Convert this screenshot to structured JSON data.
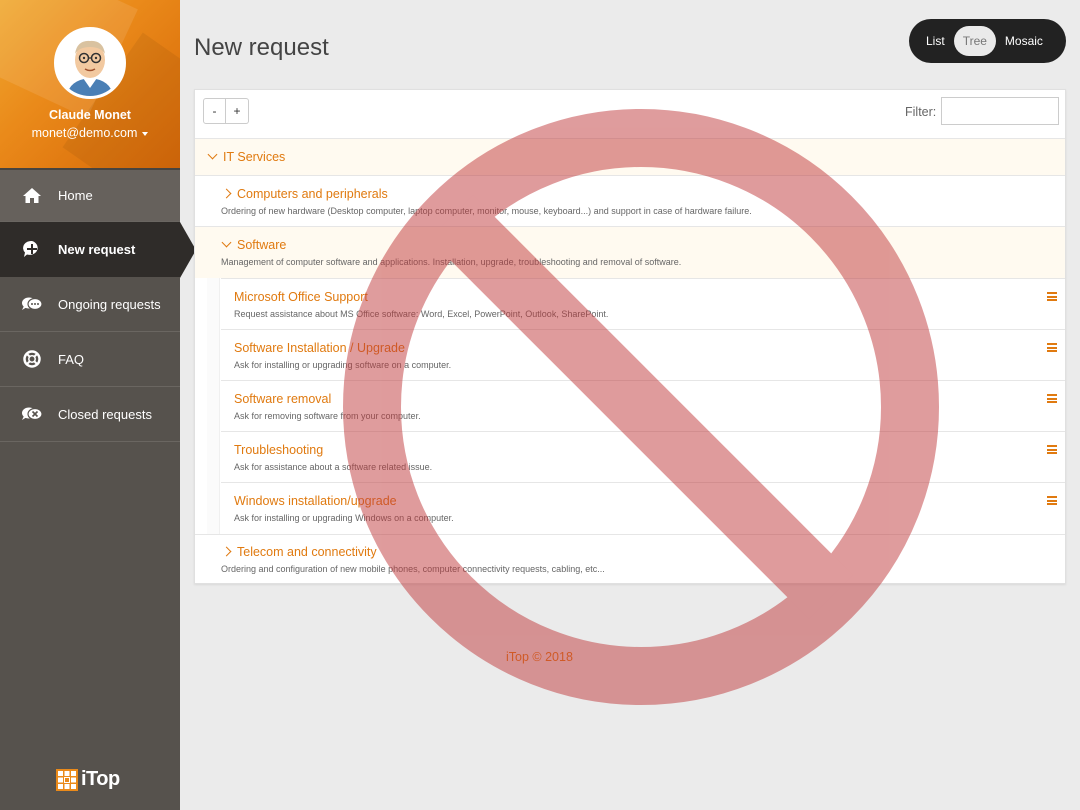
{
  "user": {
    "name": "Claude Monet",
    "email": "monet@demo.com"
  },
  "nav": [
    {
      "label": "Home",
      "icon": "home-icon"
    },
    {
      "label": "New request",
      "icon": "plus-circle-icon"
    },
    {
      "label": "Ongoing requests",
      "icon": "chat-bubbles-icon"
    },
    {
      "label": "FAQ",
      "icon": "lifebuoy-icon"
    },
    {
      "label": "Closed requests",
      "icon": "chat-closed-icon"
    }
  ],
  "logo": "iTop",
  "page": {
    "title": "New request"
  },
  "view_switch": {
    "list": "List",
    "tree": "Tree",
    "mosaic": "Mosaic",
    "active": "Tree"
  },
  "toolbar": {
    "collapse": "-",
    "expand": "+",
    "filter_label": "Filter:",
    "filter_value": ""
  },
  "tree": {
    "root": {
      "title": "IT Services"
    },
    "computers": {
      "title": "Computers and peripherals",
      "desc": "Ordering of new hardware (Desktop computer, laptop computer, monitor, mouse, keyboard...) and support in case of hardware failure."
    },
    "software": {
      "title": "Software",
      "desc": "Management of computer software and applications. Installation, upgrade, troubleshooting and removal of software."
    },
    "items": [
      {
        "title": "Microsoft Office Support",
        "desc": "Request assistance about MS Office software: Word, Excel, PowerPoint, Outlook, SharePoint."
      },
      {
        "title": "Software Installation / Upgrade",
        "desc": "Ask for installing or upgrading software on a computer."
      },
      {
        "title": "Software removal",
        "desc": "Ask for removing software from your computer."
      },
      {
        "title": "Troubleshooting",
        "desc": "Ask for assistance about a software related issue."
      },
      {
        "title": "Windows installation/upgrade",
        "desc": "Ask for installing or upgrading Windows on a computer."
      }
    ],
    "telecom": {
      "title": "Telecom and connectivity",
      "desc": "Ordering and configuration of new mobile phones, computer connectivity requests, cabling, etc..."
    }
  },
  "footer": "iTop © 2018",
  "overlay": {
    "icon": "prohibited-sign-icon",
    "color": "#c0393b"
  },
  "colors": {
    "accent": "#e07a10",
    "sidebar": "#56524d",
    "active_nav": "#2f2c29"
  }
}
